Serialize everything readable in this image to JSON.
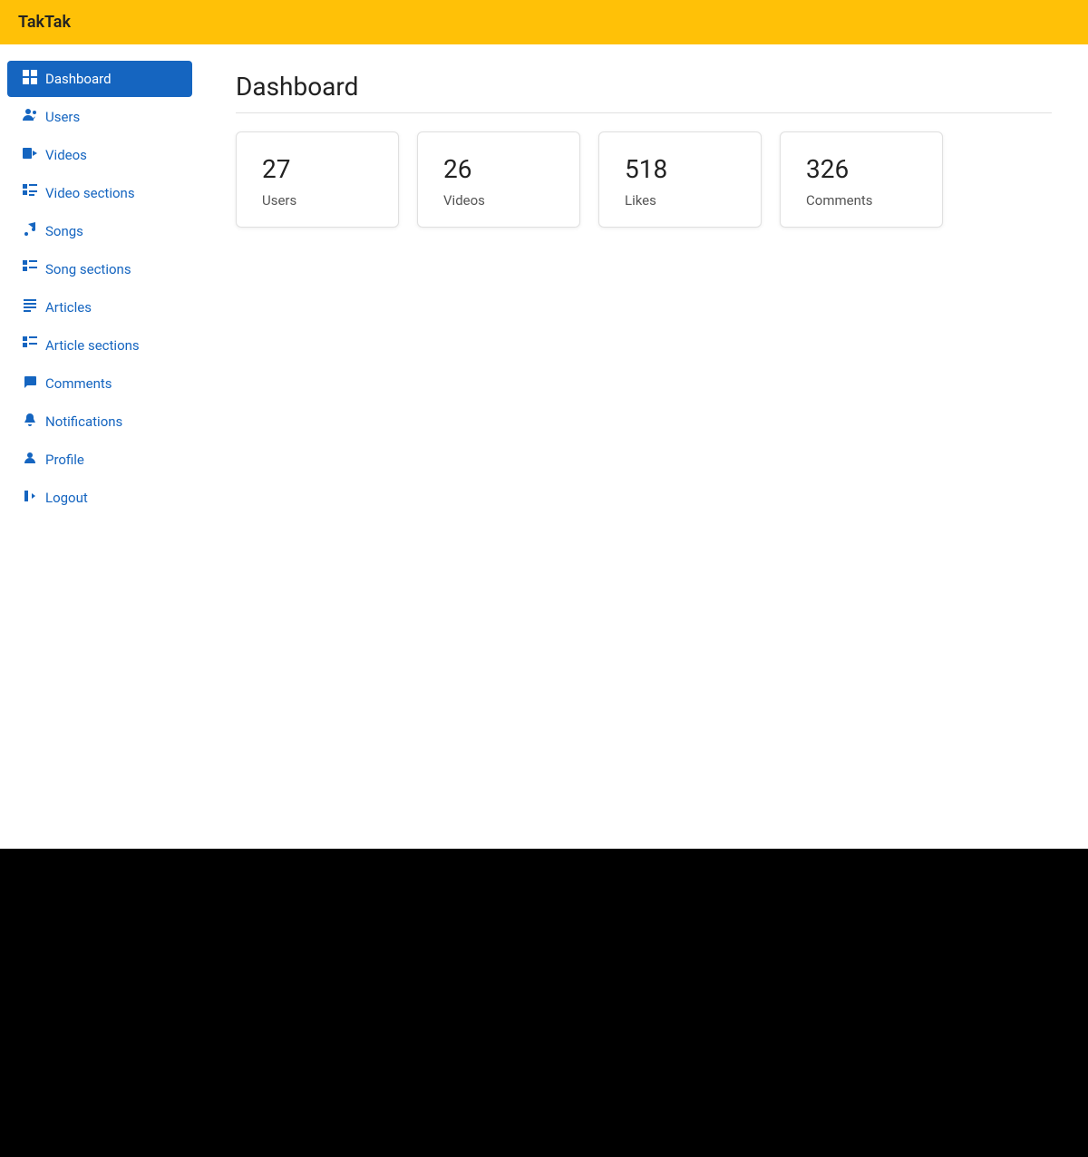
{
  "app": {
    "title": "TakTak"
  },
  "sidebar": {
    "items": [
      {
        "id": "dashboard",
        "label": "Dashboard",
        "icon": "📊",
        "active": true
      },
      {
        "id": "users",
        "label": "Users",
        "icon": "👥",
        "active": false
      },
      {
        "id": "videos",
        "label": "Videos",
        "icon": "🎬",
        "active": false
      },
      {
        "id": "video-sections",
        "label": "Video sections",
        "icon": "📋",
        "active": false
      },
      {
        "id": "songs",
        "label": "Songs",
        "icon": "🎵",
        "active": false
      },
      {
        "id": "song-sections",
        "label": "Song sections",
        "icon": "📋",
        "active": false
      },
      {
        "id": "articles",
        "label": "Articles",
        "icon": "📄",
        "active": false
      },
      {
        "id": "article-sections",
        "label": "Article sections",
        "icon": "📋",
        "active": false
      },
      {
        "id": "comments",
        "label": "Comments",
        "icon": "💬",
        "active": false
      },
      {
        "id": "notifications",
        "label": "Notifications",
        "icon": "📢",
        "active": false
      },
      {
        "id": "profile",
        "label": "Profile",
        "icon": "👤",
        "active": false
      },
      {
        "id": "logout",
        "label": "Logout",
        "icon": "🚪",
        "active": false
      }
    ]
  },
  "main": {
    "page_title": "Dashboard",
    "stats": [
      {
        "id": "users-stat",
        "number": "27",
        "label": "Users"
      },
      {
        "id": "videos-stat",
        "number": "26",
        "label": "Videos"
      },
      {
        "id": "likes-stat",
        "number": "518",
        "label": "Likes"
      },
      {
        "id": "comments-stat",
        "number": "326",
        "label": "Comments"
      }
    ]
  }
}
